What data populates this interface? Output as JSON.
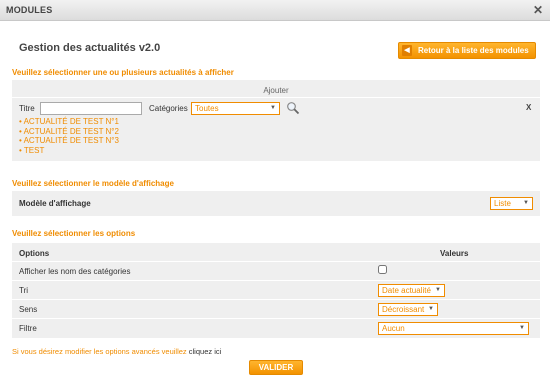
{
  "window": {
    "title": "MODULES"
  },
  "header": {
    "title": "Gestion des actualités v2.0",
    "back_button": "Retour à la liste des modules"
  },
  "news_section": {
    "heading": "Veuillez sélectionner une ou plusieurs actualités à afficher",
    "add_label": "Ajouter",
    "title_label": "Titre",
    "title_value": "",
    "categories_label": "Catégories",
    "categories_value": "Toutes",
    "remove_label": "X",
    "items": [
      "• ACTUALITÉ DE TEST N°1",
      "• ACTUALITÉ DE TEST N°2",
      "• ACTUALITÉ DE TEST N°3",
      "• TEST"
    ]
  },
  "model_section": {
    "heading": "Veuillez sélectionner le modèle d'affichage",
    "label": "Modèle d'affichage",
    "value": "Liste"
  },
  "options_section": {
    "heading": "Veuillez sélectionner les options",
    "col_options": "Options",
    "col_values": "Valeurs",
    "rows": [
      {
        "label": "Afficher les nom des catégories",
        "checked": false
      },
      {
        "label": "Tri",
        "value": "Date actualité"
      },
      {
        "label": "Sens",
        "value": "Décroissant"
      },
      {
        "label": "Filtre",
        "value": "Aucun"
      }
    ]
  },
  "footer": {
    "advanced_text": "Si vous désirez modifier les options avancés veuillez",
    "advanced_link": "cliquez ici",
    "submit": "VALIDER"
  },
  "colors": {
    "accent": "#f08c00",
    "panel": "#efefef"
  }
}
